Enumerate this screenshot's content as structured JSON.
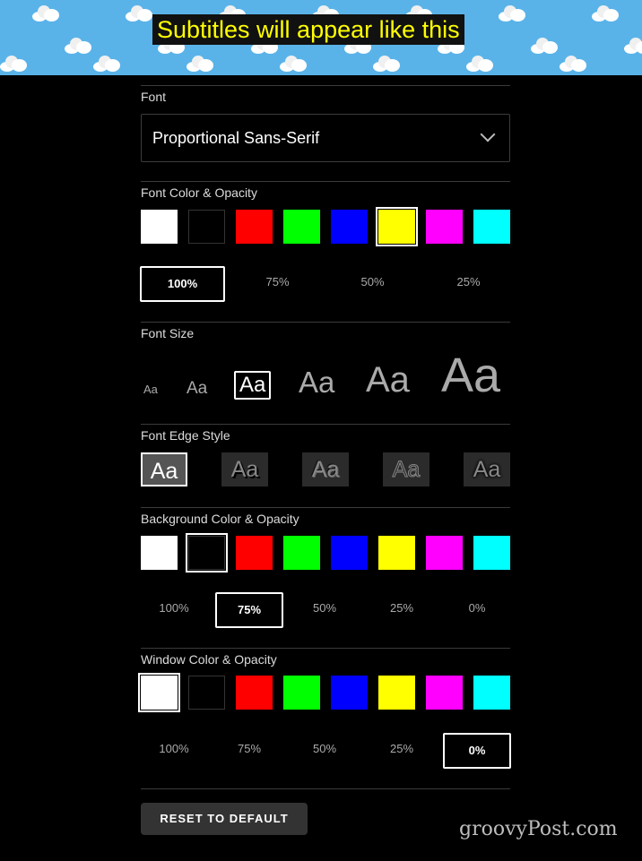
{
  "preview": {
    "text": "Subtitles will appear like this"
  },
  "font": {
    "label": "Font",
    "selected": "Proportional Sans-Serif"
  },
  "font_color": {
    "label": "Font Color & Opacity",
    "swatches": [
      "#ffffff",
      "#000000",
      "#ff0000",
      "#00ff00",
      "#0000ff",
      "#ffff00",
      "#ff00ff",
      "#00ffff"
    ],
    "selected_swatch": 5,
    "opacity": [
      "100%",
      "75%",
      "50%",
      "25%"
    ],
    "selected_opacity": 0
  },
  "font_size": {
    "label": "Font Size",
    "options": [
      "Aa",
      "Aa",
      "Aa",
      "Aa",
      "Aa",
      "Aa"
    ],
    "selected": 2
  },
  "edge_style": {
    "label": "Font Edge Style",
    "options": [
      "Aa",
      "Aa",
      "Aa",
      "Aa",
      "Aa"
    ],
    "selected": 0
  },
  "background_color": {
    "label": "Background Color & Opacity",
    "swatches": [
      "#ffffff",
      "#000000",
      "#ff0000",
      "#00ff00",
      "#0000ff",
      "#ffff00",
      "#ff00ff",
      "#00ffff"
    ],
    "selected_swatch": 1,
    "opacity": [
      "100%",
      "75%",
      "50%",
      "25%",
      "0%"
    ],
    "selected_opacity": 1
  },
  "window_color": {
    "label": "Window Color & Opacity",
    "swatches": [
      "#ffffff",
      "#000000",
      "#ff0000",
      "#00ff00",
      "#0000ff",
      "#ffff00",
      "#ff00ff",
      "#00ffff"
    ],
    "selected_swatch": 0,
    "opacity": [
      "100%",
      "75%",
      "50%",
      "25%",
      "0%"
    ],
    "selected_opacity": 4
  },
  "reset": {
    "label": "RESET TO DEFAULT"
  },
  "watermark": {
    "text": "groovyPost.com"
  }
}
